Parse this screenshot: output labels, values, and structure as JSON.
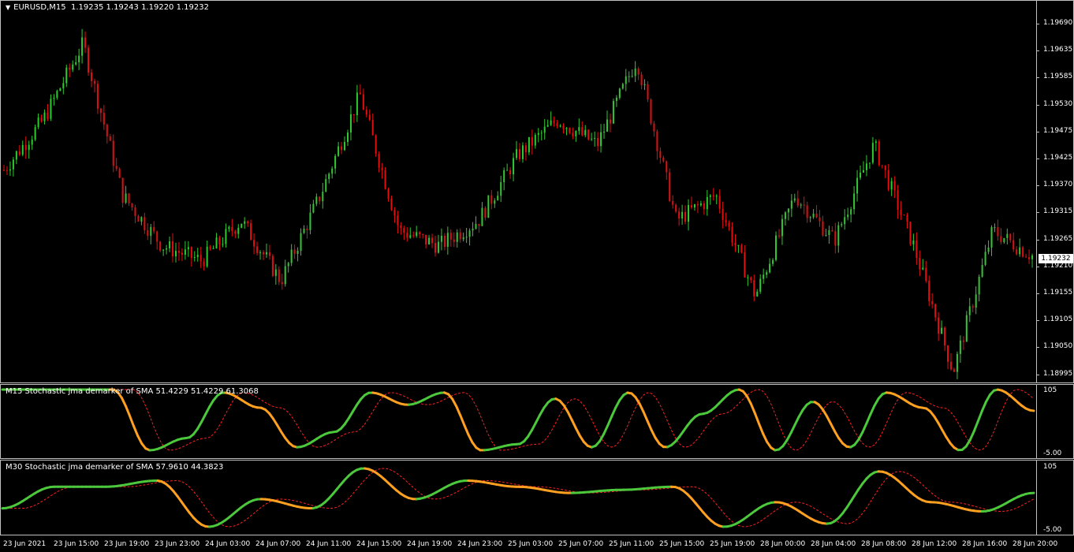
{
  "header": {
    "symbol": "EURUSD,M15",
    "quote": "1.19235 1.19243 1.19220 1.19232"
  },
  "price": {
    "current": "1.19232",
    "axis_labels": [
      "1.19690",
      "1.19635",
      "1.19585",
      "1.19530",
      "1.19475",
      "1.19425",
      "1.19370",
      "1.19315",
      "1.19265",
      "1.19210",
      "1.19155",
      "1.19105",
      "1.19050",
      "1.18995"
    ]
  },
  "indicator1": {
    "title": "M15 Stochastic jma demarker of SMA 51.4229 51.4229 61.3068",
    "top_label": "105",
    "bottom_label": "-5.00"
  },
  "indicator2": {
    "title": "M30 Stochastic jma demarker of SMA 57.9610 44.3823",
    "top_label": "105",
    "bottom_label": "-5.00"
  },
  "time_axis": [
    "23 Jun 2021",
    "23 Jun 15:00",
    "23 Jun 19:00",
    "23 Jun 23:00",
    "24 Jun 03:00",
    "24 Jun 07:00",
    "24 Jun 11:00",
    "24 Jun 15:00",
    "24 Jun 19:00",
    "24 Jun 23:00",
    "25 Jun 03:00",
    "25 Jun 07:00",
    "25 Jun 11:00",
    "25 Jun 15:00",
    "25 Jun 19:00",
    "28 Jun 00:00",
    "28 Jun 04:00",
    "28 Jun 08:00",
    "28 Jun 12:00",
    "28 Jun 16:00",
    "28 Jun 20:00"
  ],
  "colors": {
    "bull": "#32c832",
    "bear": "#e01010",
    "osc_up": "#4cc83c",
    "osc_down": "#ffa020",
    "signal": "#ff2020"
  },
  "chart_data": [
    {
      "type": "candlestick",
      "title": "EURUSD,M15",
      "x": [
        "23 Jun 2021",
        "23 Jun 15:00",
        "23 Jun 19:00",
        "23 Jun 23:00",
        "24 Jun 03:00",
        "24 Jun 07:00",
        "24 Jun 11:00",
        "24 Jun 15:00",
        "24 Jun 19:00",
        "24 Jun 23:00",
        "25 Jun 03:00",
        "25 Jun 07:00",
        "25 Jun 11:00",
        "25 Jun 15:00",
        "25 Jun 19:00",
        "28 Jun 00:00",
        "28 Jun 04:00",
        "28 Jun 08:00",
        "28 Jun 12:00",
        "28 Jun 16:00",
        "28 Jun 20:00"
      ],
      "close_path": [
        1.194,
        1.195,
        1.1965,
        1.1935,
        1.1925,
        1.1922,
        1.193,
        1.1918,
        1.1935,
        1.1955,
        1.1928,
        1.1925,
        1.193,
        1.1943,
        1.195,
        1.1945,
        1.1962,
        1.193,
        1.1935,
        1.1915,
        1.1935,
        1.1926,
        1.1945,
        1.1925,
        1.19,
        1.1928,
        1.1923
      ],
      "ylim": [
        1.18995,
        1.1969
      ]
    },
    {
      "type": "line",
      "title": "M15 Stochastic jma demarker of SMA",
      "y_main": [
        100,
        100,
        100,
        100,
        0,
        20,
        95,
        70,
        5,
        30,
        95,
        75,
        95,
        0,
        10,
        85,
        5,
        95,
        5,
        60,
        100,
        0,
        80,
        5,
        95,
        70,
        0,
        100,
        65
      ],
      "ylim": [
        -5,
        105
      ]
    },
    {
      "type": "line",
      "title": "M30 Stochastic jma demarker of SMA",
      "y_main": [
        30,
        65,
        65,
        75,
        0,
        45,
        30,
        95,
        45,
        75,
        65,
        55,
        60,
        65,
        0,
        40,
        5,
        90,
        40,
        25,
        55
      ],
      "ylim": [
        -5,
        105
      ]
    }
  ]
}
